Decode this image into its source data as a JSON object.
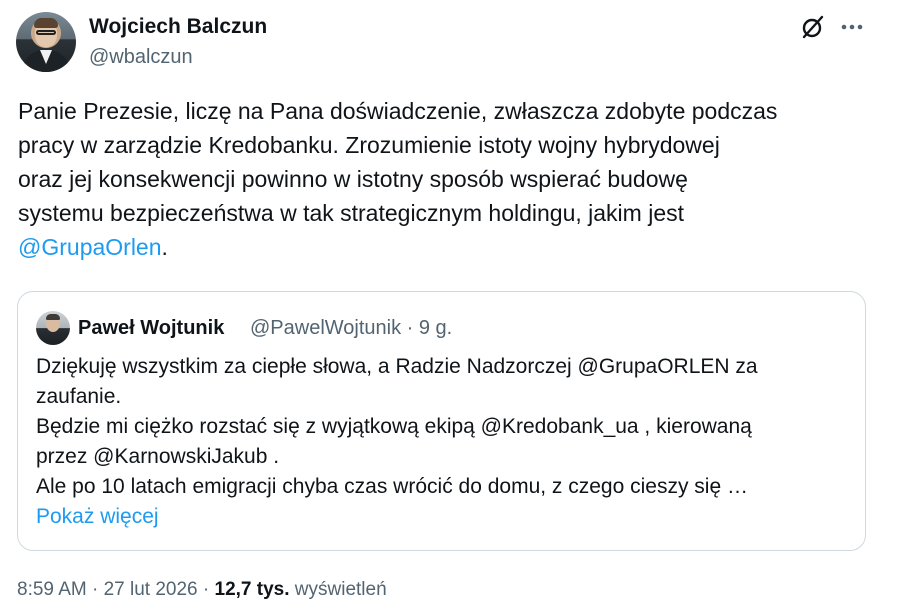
{
  "author": {
    "display_name": "Wojciech Balczun",
    "handle": "@wbalczun",
    "avatar_icon": "profile-photo"
  },
  "header_icons": {
    "grok": "grok-icon",
    "more": "more-horizontal-icon"
  },
  "tweet": {
    "lines": [
      "Panie Prezesie, liczę na Pana doświadczenie, zwłaszcza zdobyte podczas",
      "pracy w zarządzie Kredobanku. Zrozumienie istoty wojny hybrydowej",
      "oraz jej konsekwencji powinno w istotny sposób wspierać budowę",
      "systemu bezpieczeństwa w tak strategicznym holdingu, jakim jest"
    ],
    "mention": "@GrupaOrlen",
    "mention_suffix": "."
  },
  "quote": {
    "display_name": "Paweł Wojtunik",
    "handle_time": "@PawelWojtunik · 9 g.",
    "lines": [
      "Dziękuję wszystkim za ciepłe słowa, a Radzie Nadzorczej @GrupaORLEN za",
      "zaufanie.",
      "Będzie mi ciężko rozstać się z wyjątkową ekipą @Kredobank_ua , kierowaną",
      "przez @KarnowskiJakub .",
      "Ale po 10 latach emigracji chyba czas wrócić do domu, z czego cieszy się …"
    ],
    "show_more": "Pokaż więcej"
  },
  "meta": {
    "time_date": "8:59 AM · 27 lut 2026 · ",
    "views_count": "12,7 tys.",
    "views_label": " wyświetleń"
  },
  "colors": {
    "link": "#1d9bf0",
    "text": "#0f1419",
    "secondary": "#536471",
    "border": "#cfd9de"
  }
}
